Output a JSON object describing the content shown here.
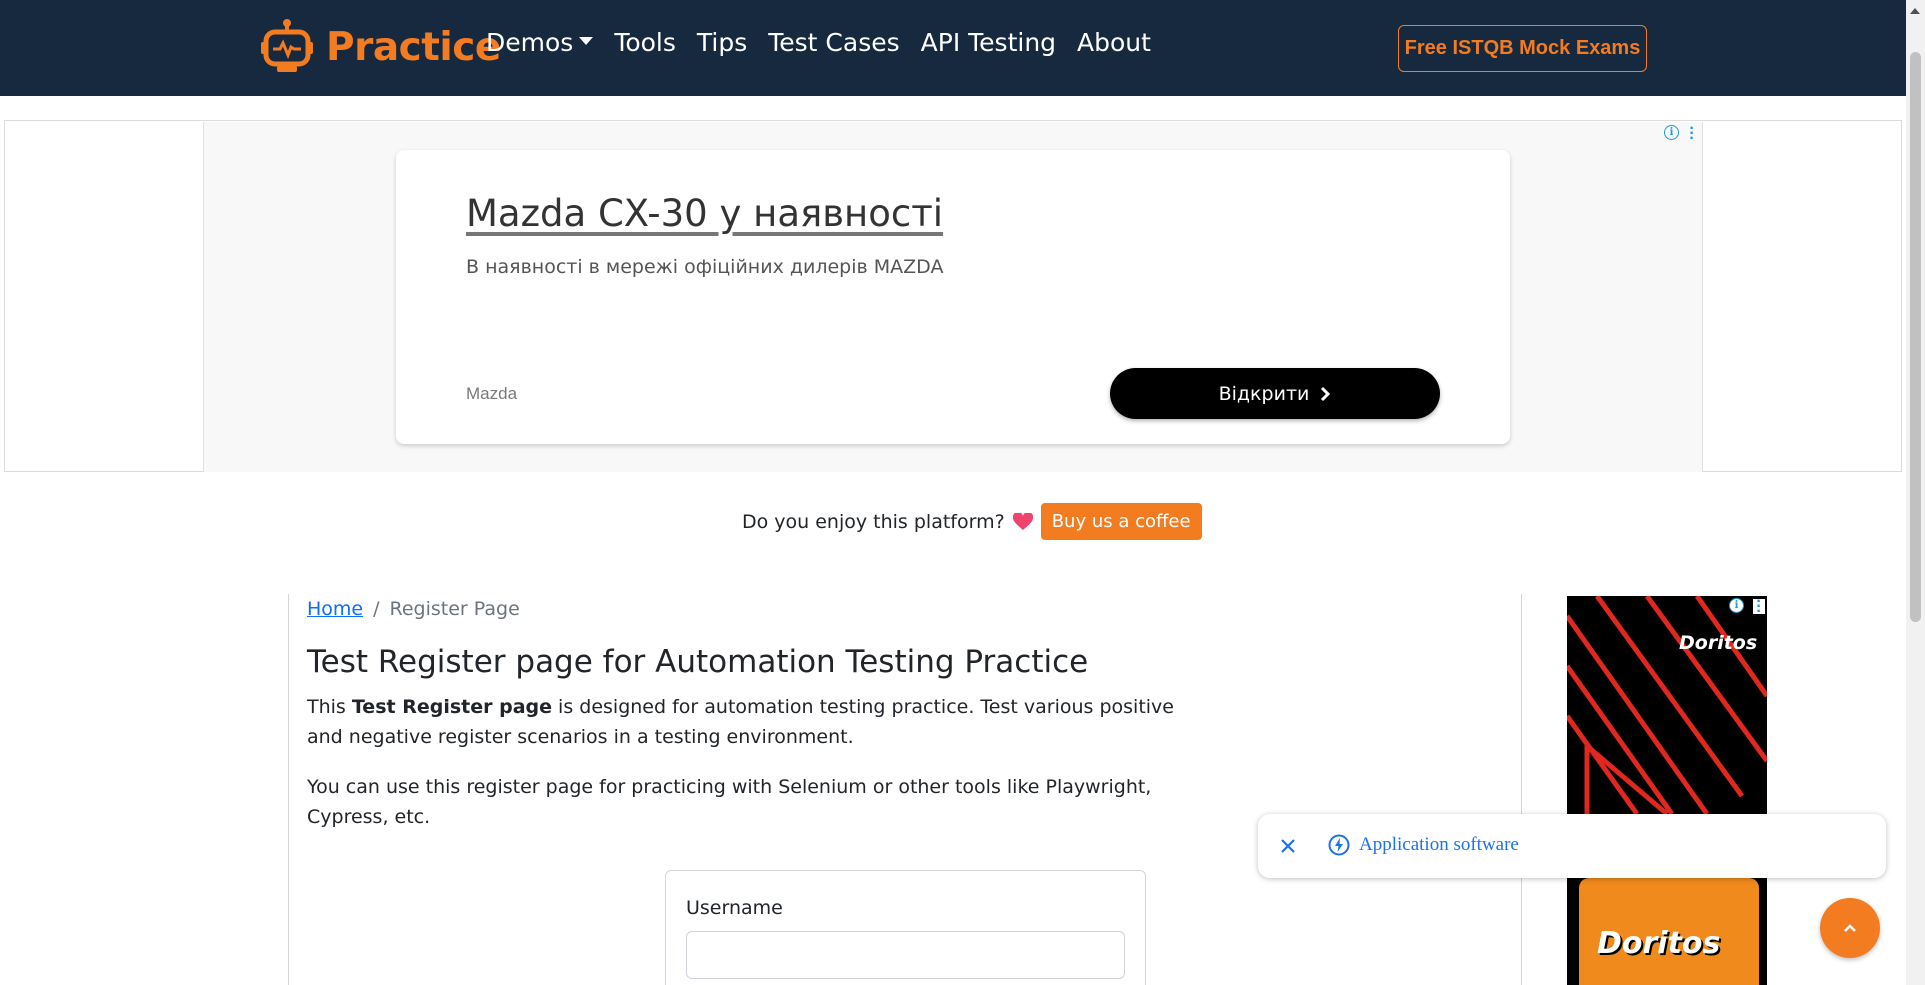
{
  "navbar": {
    "brand": "Practice",
    "links": [
      "Demos",
      "Tools",
      "Tips",
      "Test Cases",
      "API Testing",
      "About"
    ],
    "cta": "Free ISTQB Mock Exams",
    "colors": {
      "background": "#17293f",
      "accent": "#f47c20"
    }
  },
  "top_ad": {
    "title": "Mazda CX-30 у наявності",
    "description": "В наявності в мережі офіційних дилерів MAZDA",
    "advertiser": "Mazda",
    "button_label": "Відкрити"
  },
  "support": {
    "text": "Do you enjoy this platform?",
    "button_label": "Buy us a coffee"
  },
  "breadcrumb": {
    "home": "Home",
    "separator": "/",
    "current": "Register Page"
  },
  "main": {
    "title": "Test Register page for Automation Testing Practice",
    "intro_prefix": "This ",
    "intro_bold": "Test Register page",
    "intro_suffix": " is designed for automation testing practice. Test various positive and negative register scenarios in a testing environment.",
    "tools_note": "You can use this register page for practicing with Selenium or other tools like Playwright, Cypress, etc."
  },
  "form": {
    "username_label": "Username",
    "username_value": ""
  },
  "side_ad": {
    "brand_top": "Doritos",
    "brand_bag": "Doritos"
  },
  "popup": {
    "text": "Application software"
  }
}
